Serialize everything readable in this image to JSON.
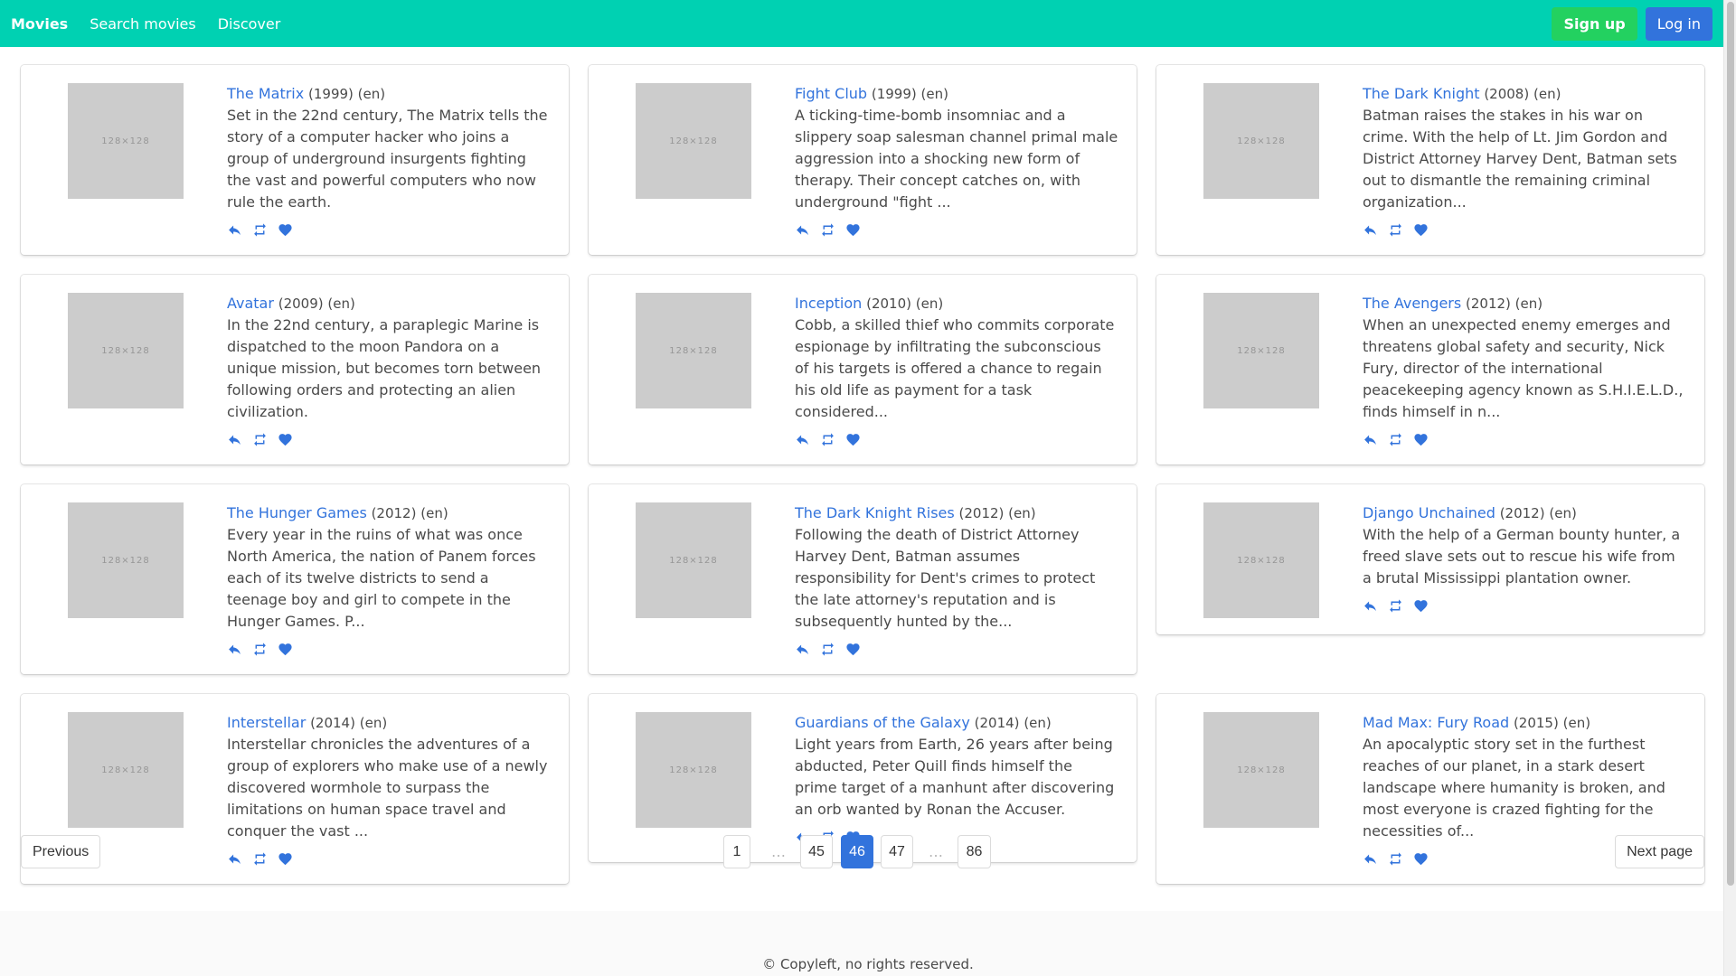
{
  "nav": {
    "brand": "Movies",
    "items": [
      "Search movies",
      "Discover"
    ],
    "signup_label": "Sign up",
    "login_label": "Log in"
  },
  "colors": {
    "navbar": "#00d1b2",
    "signup": "#23d160",
    "primary": "#3273dc"
  },
  "thumb_label": "128×128",
  "movies": [
    {
      "title": "The Matrix",
      "year": "(1999)",
      "lang": "(en)",
      "overview": "Set in the 22nd century, The Matrix tells the story of a computer hacker who joins a group of underground insurgents fighting the vast and powerful computers who now rule the earth."
    },
    {
      "title": "Fight Club",
      "year": "(1999)",
      "lang": "(en)",
      "overview": "A ticking-time-bomb insomniac and a slippery soap salesman channel primal male aggression into a shocking new form of therapy. Their concept catches on, with underground \"fight ..."
    },
    {
      "title": "The Dark Knight",
      "year": "(2008)",
      "lang": "(en)",
      "overview": "Batman raises the stakes in his war on crime. With the help of Lt. Jim Gordon and District Attorney Harvey Dent, Batman sets out to dismantle the remaining criminal organization..."
    },
    {
      "title": "Avatar",
      "year": "(2009)",
      "lang": "(en)",
      "overview": "In the 22nd century, a paraplegic Marine is dispatched to the moon Pandora on a unique mission, but becomes torn between following orders and protecting an alien civilization."
    },
    {
      "title": "Inception",
      "year": "(2010)",
      "lang": "(en)",
      "overview": "Cobb, a skilled thief who commits corporate espionage by infiltrating the subconscious of his targets is offered a chance to regain his old life as payment for a task considered..."
    },
    {
      "title": "The Avengers",
      "year": "(2012)",
      "lang": "(en)",
      "overview": "When an unexpected enemy emerges and threatens global safety and security, Nick Fury, director of the international peacekeeping agency known as S.H.I.E.L.D., finds himself in n..."
    },
    {
      "title": "The Hunger Games",
      "year": "(2012)",
      "lang": "(en)",
      "overview": "Every year in the ruins of what was once North America, the nation of Panem forces each of its twelve districts to send a teenage boy and girl to compete in the Hunger Games. P..."
    },
    {
      "title": "The Dark Knight Rises",
      "year": "(2012)",
      "lang": "(en)",
      "overview": "Following the death of District Attorney Harvey Dent, Batman assumes responsibility for Dent's crimes to protect the late attorney's reputation and is subsequently hunted by the..."
    },
    {
      "title": "Django Unchained",
      "year": "(2012)",
      "lang": "(en)",
      "overview": "With the help of a German bounty hunter, a freed slave sets out to rescue his wife from a brutal Mississippi plantation owner."
    },
    {
      "title": "Interstellar",
      "year": "(2014)",
      "lang": "(en)",
      "overview": "Interstellar chronicles the adventures of a group of explorers who make use of a newly discovered wormhole to surpass the limitations on human space travel and conquer the vast ..."
    },
    {
      "title": "Guardians of the Galaxy",
      "year": "(2014)",
      "lang": "(en)",
      "overview": "Light years from Earth, 26 years after being abducted, Peter Quill finds himself the prime target of a manhunt after discovering an orb wanted by Ronan the Accuser."
    },
    {
      "title": "Mad Max: Fury Road",
      "year": "(2015)",
      "lang": "(en)",
      "overview": "An apocalyptic story set in the furthest reaches of our planet, in a stark desert landscape where humanity is broken, and most everyone is crazed fighting for the necessities of..."
    }
  ],
  "action_icons": [
    "reply-icon",
    "retweet-icon",
    "heart-icon"
  ],
  "pagination": {
    "previous_label": "Previous",
    "next_label": "Next page",
    "first": "1",
    "ellipsis": "…",
    "prev_page": "45",
    "current": "46",
    "next_page": "47",
    "last": "86"
  },
  "footer": {
    "text": "© Copyleft, no rights reserved."
  }
}
